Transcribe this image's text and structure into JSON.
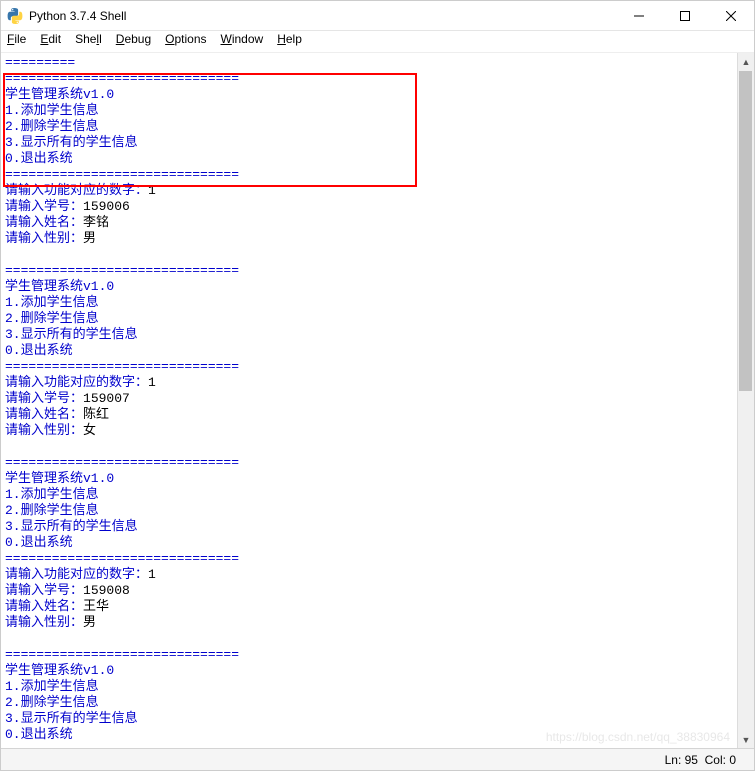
{
  "window": {
    "title": "Python 3.7.4 Shell"
  },
  "menu": {
    "file": "File",
    "edit": "Edit",
    "shell": "Shell",
    "debug": "Debug",
    "options": "Options",
    "window": "Window",
    "help": "Help"
  },
  "shell": {
    "top_sep": "=========",
    "divider": "==============================",
    "menu_title": "学生管理系统v1.0",
    "menu_item1": "1.添加学生信息",
    "menu_item2": "2.删除学生信息",
    "menu_item3": "3.显示所有的学生信息",
    "menu_item0": "0.退出系统",
    "prompt_func": "请输入功能对应的数字：",
    "prompt_id": "请输入学号：",
    "prompt_name": "请输入姓名：",
    "prompt_sex": "请输入性别：",
    "input_choice": "1",
    "student1_id": "159006",
    "student1_name": "李铭",
    "student1_sex": "男",
    "student2_id": "159007",
    "student2_name": "陈红",
    "student2_sex": "女",
    "student3_id": "159008",
    "student3_name": "王华",
    "student3_sex": "男"
  },
  "status": {
    "line": "Ln: 95",
    "col": "Col: 0"
  },
  "watermark": "https://blog.csdn.net/qq_38830964"
}
